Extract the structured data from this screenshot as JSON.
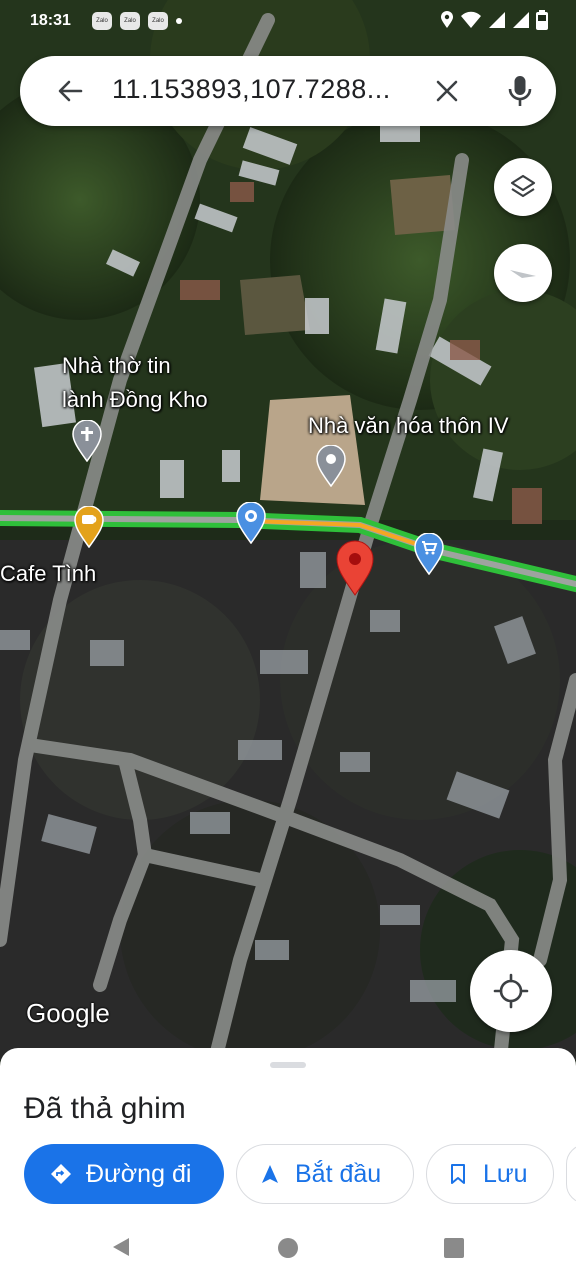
{
  "status_bar": {
    "time": "18:31",
    "notifications": [
      "Zalo",
      "Zalo",
      "Zalo"
    ]
  },
  "search": {
    "query": "11.153893,107.7288...",
    "back_icon": "arrow-left-icon",
    "clear_icon": "close-icon",
    "mic_icon": "microphone-icon"
  },
  "map": {
    "labels": {
      "church_line1": "Nhà thờ tin",
      "church_line2": "lành Đồng Kho",
      "culture_house": "Nhà văn hóa thôn IV",
      "cafe": "Cafe Tình"
    },
    "attribution": "Google",
    "colors": {
      "road_traffic": "#2fbf3a",
      "road_traffic_slow": "#f5a623",
      "pin": "#ea4335",
      "poi_blue": "#4a90e2",
      "poi_cafe": "#e3a21a",
      "poi_gray": "#8a9099"
    }
  },
  "sheet": {
    "title": "Đã thả ghim",
    "chips": {
      "directions": "Đường đi",
      "start": "Bắt đầu",
      "save": "Lưu"
    }
  }
}
